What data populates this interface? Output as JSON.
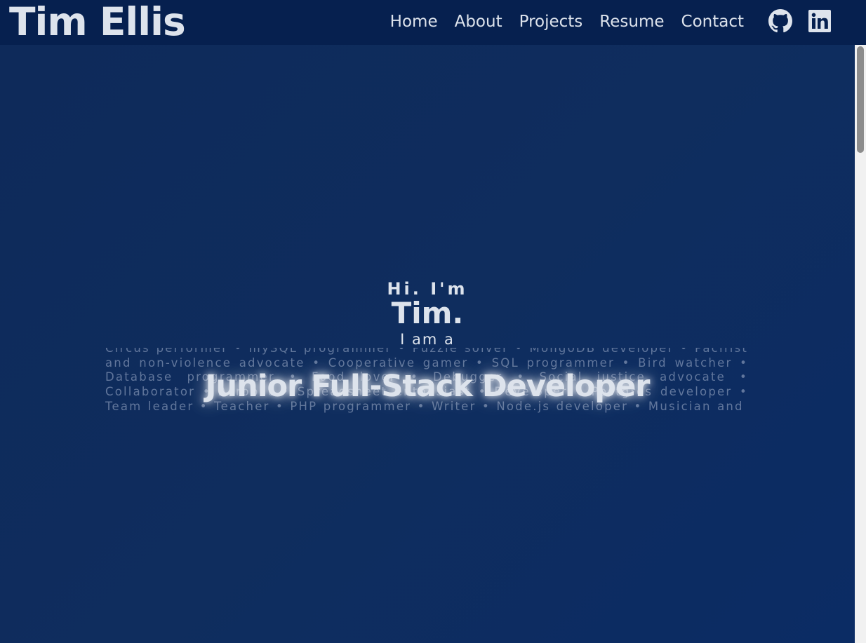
{
  "brand": "Tim Ellis",
  "nav": [
    "Home",
    "About",
    "Projects",
    "Resume",
    "Contact"
  ],
  "social": {
    "github_icon": "github-icon",
    "linkedin_icon": "linkedin-icon"
  },
  "hero": {
    "hi": "Hi. I'm",
    "name": "Tim.",
    "iama": "I am a",
    "headline": "Junior Full-Stack Developer",
    "roles_text": "Circus performer • mySQL programmer • Puzzle solver • MongoDB developer • Pacifist and non-violence advocate • Cooperative gamer • SQL programmer • Bird watcher • Database programmer • Food lover • Debugger • Social justice advocate • Collaborator • Acrobat • Spreadsheet enthusiast • Developer • Postgres developer • Team leader • Teacher • PHP programmer • Writer • Node.js developer • Musician and"
  },
  "colors": {
    "nav_bg": "#06204f",
    "hero_bg": "#0e2a5a",
    "text": "#dde3ec"
  }
}
